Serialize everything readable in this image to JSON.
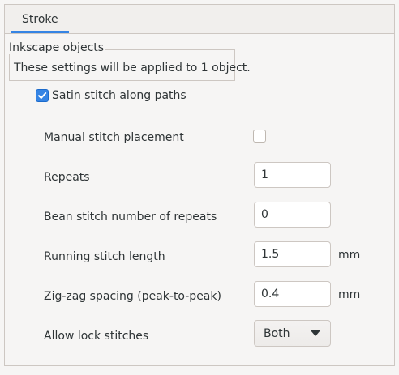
{
  "tabs": [
    {
      "label": "Stroke"
    }
  ],
  "frame": {
    "title": "Inkscape objects",
    "message": "These settings will be applied to 1 object."
  },
  "satin": {
    "label": "Satin stitch along paths",
    "checked": true
  },
  "params": {
    "manual": {
      "label": "Manual stitch placement",
      "checked": false
    },
    "repeats": {
      "label": "Repeats",
      "value": "1"
    },
    "bean": {
      "label": "Bean stitch number of repeats",
      "value": "0"
    },
    "running": {
      "label": "Running stitch length",
      "value": "1.5",
      "unit": "mm"
    },
    "zigzag": {
      "label": "Zig-zag spacing (peak-to-peak)",
      "value": "0.4",
      "unit": "mm"
    },
    "lock": {
      "label": "Allow lock stitches",
      "value": "Both"
    }
  },
  "colors": {
    "accent": "#3584e4",
    "background": "#f6f5f4",
    "border": "#cdc7c2"
  }
}
